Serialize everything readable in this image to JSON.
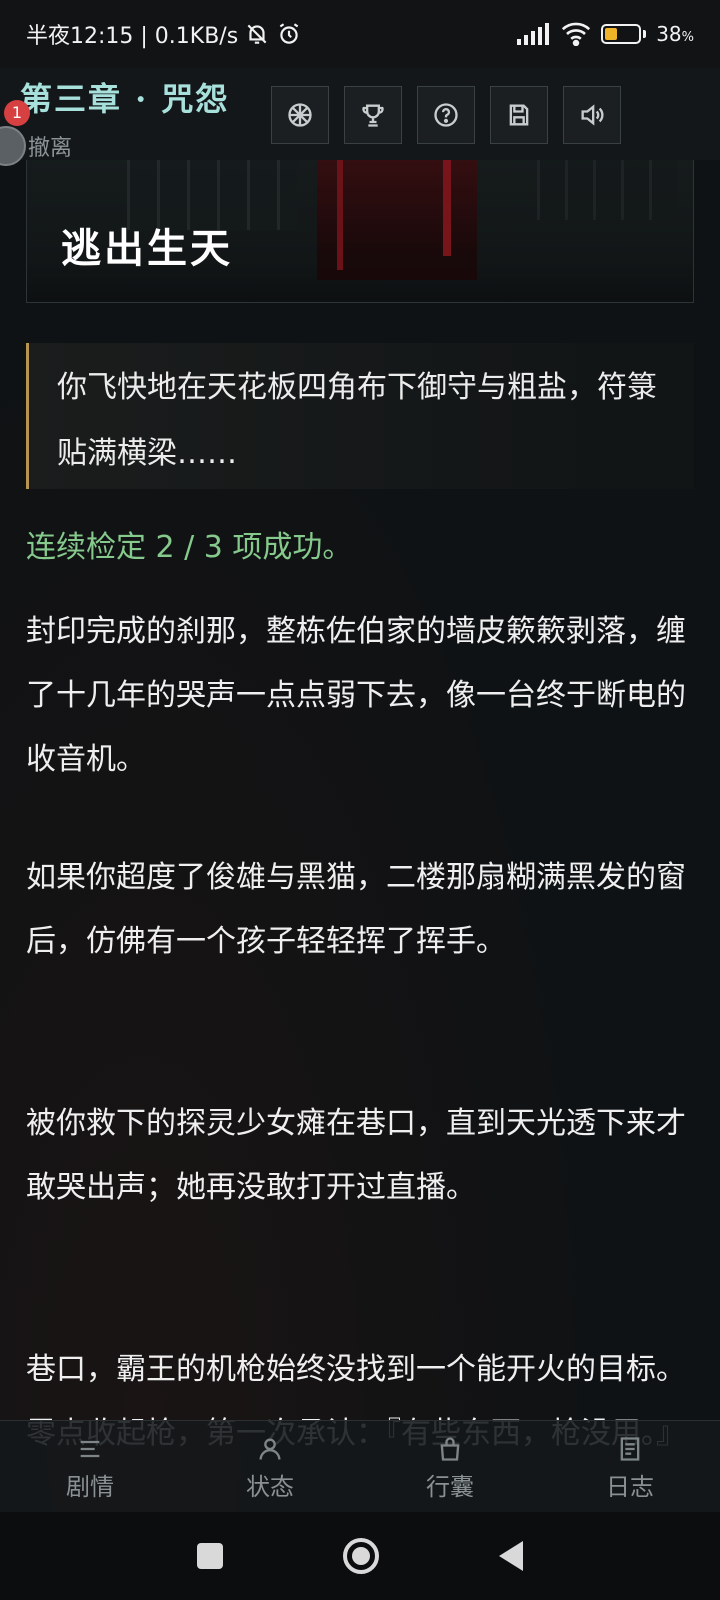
{
  "status_bar": {
    "time": "半夜12:15 | 0.1KB/s",
    "battery_percent": "38",
    "battery_suffix": "%",
    "battery_level": 0.38
  },
  "header": {
    "chapter_title": "第三章 · 咒怨",
    "undo_label": "撤离",
    "notification_badge": "1",
    "tools": [
      "wheel-icon",
      "trophy-icon",
      "help-icon",
      "save-icon",
      "volume-icon"
    ]
  },
  "hero": {
    "title": "逃出生天"
  },
  "story": {
    "quote": "你飞快地在天花板四角布下御守与粗盐，符箓贴满横梁……",
    "check_result": "连续检定 2 / 3 项成功。",
    "paragraphs": [
      "封印完成的刹那，整栋佐伯家的墙皮簌簌剥落，缠了十几年的哭声一点点弱下去，像一台终于断电的收音机。",
      "如果你超度了俊雄与黑猫，二楼那扇糊满黑发的窗后，仿佛有一个孩子轻轻挥了挥手。",
      "被你救下的探灵少女瘫在巷口，直到天光透下来才敢哭出声；她再没敢打开过直播。",
      "巷口，霸王的机枪始终没找到一个能开火的目标。零点收起枪，第一次承认：『有些东西，枪没用。』"
    ]
  },
  "bottom_nav": {
    "items": [
      {
        "label": "剧情",
        "icon": "menu-icon"
      },
      {
        "label": "状态",
        "icon": "user-icon"
      },
      {
        "label": "行囊",
        "icon": "bag-icon"
      },
      {
        "label": "日志",
        "icon": "log-icon"
      }
    ]
  },
  "colors": {
    "accent_title": "#a8e0dc",
    "success_text": "#86c98c",
    "quote_border": "#b99451"
  }
}
